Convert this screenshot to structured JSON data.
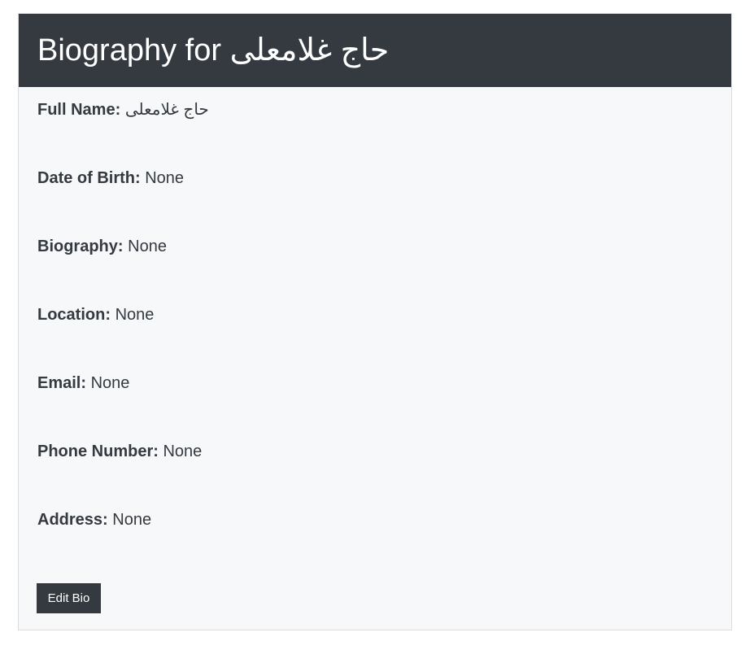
{
  "header": {
    "title_prefix": "Biography for",
    "title_name": "حاج غلامعلی"
  },
  "fields": [
    {
      "label": "Full Name:",
      "value": "حاج غلامعلی"
    },
    {
      "label": "Date of Birth:",
      "value": "None"
    },
    {
      "label": "Biography:",
      "value": "None"
    },
    {
      "label": "Location:",
      "value": "None"
    },
    {
      "label": "Email:",
      "value": "None"
    },
    {
      "label": "Phone Number:",
      "value": "None"
    },
    {
      "label": "Address:",
      "value": "None"
    }
  ],
  "actions": {
    "edit_label": "Edit Bio"
  }
}
